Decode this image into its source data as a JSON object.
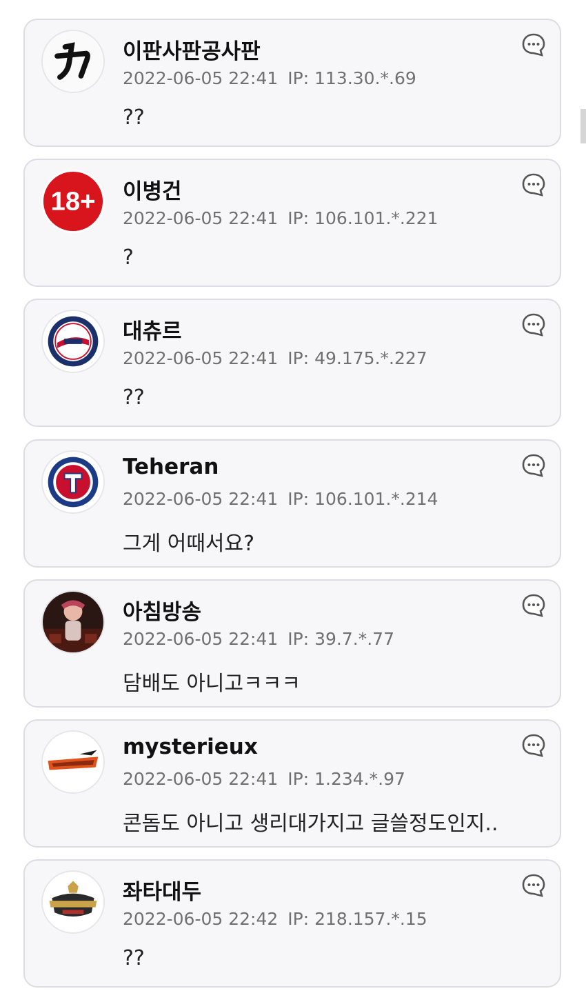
{
  "comments": [
    {
      "nickname": "이판사판공사판",
      "date": "2022-06-05 22:41",
      "ip": "IP: 113.30.*.69",
      "text": "??",
      "avatar_icon": "calligraphy-logo-icon"
    },
    {
      "nickname": "이병건",
      "date": "2022-06-05 22:41",
      "ip": "IP: 106.101.*.221",
      "text": "?",
      "avatar_icon": "age-18-plus-icon",
      "avatar_text": "18+"
    },
    {
      "nickname": "대츄르",
      "date": "2022-06-05 22:41",
      "ip": "IP: 49.175.*.227",
      "text": "??",
      "avatar_icon": "twins-logo-icon"
    },
    {
      "nickname": "Teheran",
      "date": "2022-06-05 22:41",
      "ip": "IP: 106.101.*.214",
      "text": "그게 어때서요?",
      "avatar_icon": "rangers-logo-icon"
    },
    {
      "nickname": "아침방송",
      "date": "2022-06-05 22:41",
      "ip": "IP: 39.7.*.77",
      "text": "담배도 아니고ㅋㅋㅋ",
      "avatar_icon": "photo-avatar-icon"
    },
    {
      "nickname": "mysterieux",
      "date": "2022-06-05 22:41",
      "ip": "IP: 1.234.*.97",
      "text": "콘돔도 아니고 생리대가지고 글쓸정도인지..",
      "avatar_icon": "eagles-logo-icon"
    },
    {
      "nickname": "좌타대두",
      "date": "2022-06-05 22:42",
      "ip": "IP: 218.157.*.15",
      "text": "??",
      "avatar_icon": "champions-logo-icon"
    }
  ],
  "reply_icon": "speech-bubble-icon",
  "colors": {
    "card_bg": "#f7f7f9",
    "card_border": "#dcdce4",
    "meta_text": "#707070",
    "badge_red": "#d8141c"
  }
}
